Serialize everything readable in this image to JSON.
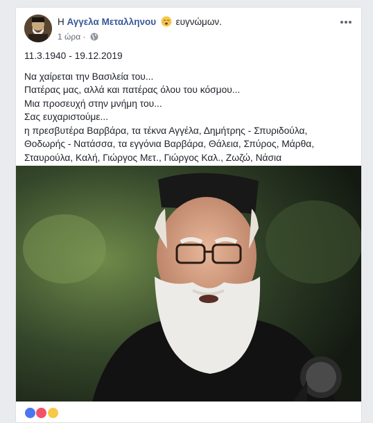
{
  "post": {
    "author_prefix": "Η",
    "author_name": "Αγγελα Μεταλληνου",
    "feeling_text": "ευγνώμων.",
    "feeling_icon": "grateful-face-emoji",
    "time": "1 ώρα",
    "time_separator": "·",
    "privacy_icon": "globe-icon",
    "more_icon": "more-options-icon",
    "dates": "11.3.1940 - 19.12.2019",
    "lines": [
      "Να χαίρεται την Βασιλεία του...",
      "Πατέρας μας, αλλά και πατέρας όλου του κόσμου...",
      "Μια προσευχή στην μνήμη του...",
      "Σας ευχαριστούμε...",
      "η πρεσβυτέρα Βαρβάρα, τα τέκνα Αγγέλα, Δημήτρης - Σπυριδούλα,",
      "Θοδωρής - Νατάσσα, τα εγγόνια Βαρβάρα, Θάλεια, Σπύρος, Μάρθα,",
      "Σταυρούλα, Καλή, Γιώργος Μετ., Γιώργος Καλ., Ζωζώ, Νάσια"
    ],
    "photo_subject": "elderly-priest-portrait",
    "reactions": [
      "like",
      "love",
      "wow"
    ]
  },
  "colors": {
    "page_background": "#e9ebee",
    "card_background": "#ffffff",
    "link": "#385898",
    "text": "#1d2129",
    "meta_text": "#616770"
  }
}
